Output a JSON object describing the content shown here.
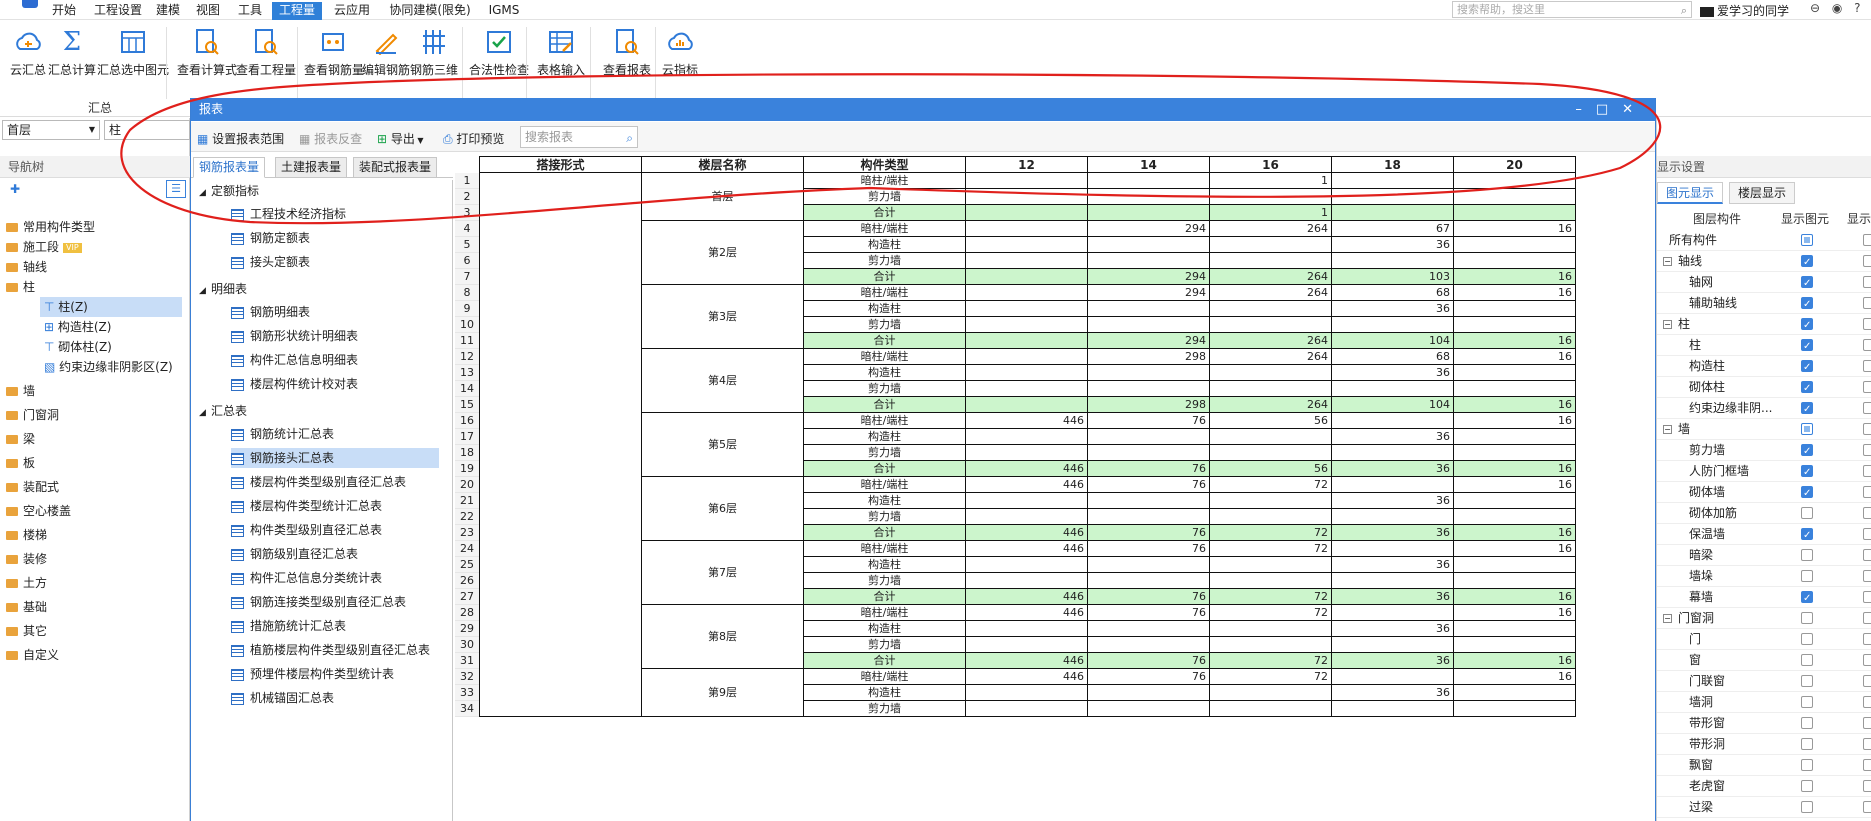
{
  "menu": {
    "items": [
      "开始",
      "工程设置",
      "建模",
      "视图",
      "工具",
      "工程量",
      "云应用",
      "协同建模(限免)",
      "IGMS"
    ],
    "active": "工程量",
    "search_placeholder": "搜索帮助，搜这里",
    "user": "爱学习的同学",
    "right_icons": "⊖ ◉ ? -"
  },
  "ribbon": {
    "buttons": [
      "云汇总",
      "汇总计算",
      "汇总选中图元",
      "查看计算式",
      "查看工程量",
      "查看钢筋量",
      "编辑钢筋",
      "钢筋三维",
      "合法性检查",
      "表格输入",
      "查看报表",
      "云指标"
    ],
    "group_label": "汇总"
  },
  "left": {
    "floor": "首层",
    "type": "柱",
    "nav_title": "导航树",
    "items": [
      "常用构件类型",
      "施工段",
      "轴线",
      "柱",
      "柱(Z)",
      "构造柱(Z)",
      "砌体柱(Z)",
      "约束边缘非阴影区(Z)",
      "墙",
      "门窗洞",
      "梁",
      "板",
      "装配式",
      "空心楼盖",
      "楼梯",
      "装修",
      "土方",
      "基础",
      "其它",
      "自定义"
    ],
    "vip": "VIP"
  },
  "dialog": {
    "title": "报表",
    "toolbar": {
      "set_range": "设置报表范围",
      "check": "报表反查",
      "export": "导出",
      "print": "打印预览",
      "search_placeholder": "搜索报表"
    },
    "tabs": [
      "钢筋报表量",
      "土建报表量",
      "装配式报表量"
    ],
    "tree": {
      "groups": [
        "定额指标",
        "明细表",
        "汇总表"
      ],
      "g1": [
        "工程技术经济指标",
        "钢筋定额表",
        "接头定额表"
      ],
      "g2": [
        "钢筋明细表",
        "钢筋形状统计明细表",
        "构件汇总信息明细表",
        "楼层构件统计校对表"
      ],
      "g3": [
        "钢筋统计汇总表",
        "钢筋接头汇总表",
        "楼层构件类型级别直径汇总表",
        "楼层构件类型统计汇总表",
        "构件类型级别直径汇总表",
        "钢筋级别直径汇总表",
        "构件汇总信息分类统计表",
        "钢筋连接类型级别直径汇总表",
        "措施筋统计汇总表",
        "植筋楼层构件类型级别直径汇总表",
        "预埋件楼层构件类型统计表",
        "机械锚固汇总表"
      ],
      "selected": "钢筋接头汇总表"
    },
    "table": {
      "headers": [
        "搭接形式",
        "楼层名称",
        "构件类型",
        "12",
        "14",
        "16",
        "18",
        "20"
      ],
      "floors": [
        {
          "name": "首层",
          "rows": [
            [
              "暗柱/端柱",
              "",
              "",
              "1",
              "",
              ""
            ],
            [
              "剪力墙",
              "",
              "",
              "",
              "",
              ""
            ],
            [
              "合计",
              "",
              "",
              "1",
              "",
              ""
            ]
          ]
        },
        {
          "name": "第2层",
          "rows": [
            [
              "暗柱/端柱",
              "",
              "294",
              "264",
              "67",
              "16"
            ],
            [
              "构造柱",
              "",
              "",
              "",
              "36",
              ""
            ],
            [
              "剪力墙",
              "",
              "",
              "",
              "",
              ""
            ],
            [
              "合计",
              "",
              "294",
              "264",
              "103",
              "16"
            ]
          ]
        },
        {
          "name": "第3层",
          "rows": [
            [
              "暗柱/端柱",
              "",
              "294",
              "264",
              "68",
              "16"
            ],
            [
              "构造柱",
              "",
              "",
              "",
              "36",
              ""
            ],
            [
              "剪力墙",
              "",
              "",
              "",
              "",
              ""
            ],
            [
              "合计",
              "",
              "294",
              "264",
              "104",
              "16"
            ]
          ]
        },
        {
          "name": "第4层",
          "rows": [
            [
              "暗柱/端柱",
              "",
              "298",
              "264",
              "68",
              "16"
            ],
            [
              "构造柱",
              "",
              "",
              "",
              "36",
              ""
            ],
            [
              "剪力墙",
              "",
              "",
              "",
              "",
              ""
            ],
            [
              "合计",
              "",
              "298",
              "264",
              "104",
              "16"
            ]
          ]
        },
        {
          "name": "第5层",
          "rows": [
            [
              "暗柱/端柱",
              "446",
              "76",
              "56",
              "",
              "16"
            ],
            [
              "构造柱",
              "",
              "",
              "",
              "36",
              ""
            ],
            [
              "剪力墙",
              "",
              "",
              "",
              "",
              ""
            ],
            [
              "合计",
              "446",
              "76",
              "56",
              "36",
              "16"
            ]
          ]
        },
        {
          "name": "第6层",
          "rows": [
            [
              "暗柱/端柱",
              "446",
              "76",
              "72",
              "",
              "16"
            ],
            [
              "构造柱",
              "",
              "",
              "",
              "36",
              ""
            ],
            [
              "剪力墙",
              "",
              "",
              "",
              "",
              ""
            ],
            [
              "合计",
              "446",
              "76",
              "72",
              "36",
              "16"
            ]
          ]
        },
        {
          "name": "第7层",
          "rows": [
            [
              "暗柱/端柱",
              "446",
              "76",
              "72",
              "",
              "16"
            ],
            [
              "构造柱",
              "",
              "",
              "",
              "36",
              ""
            ],
            [
              "剪力墙",
              "",
              "",
              "",
              "",
              ""
            ],
            [
              "合计",
              "446",
              "76",
              "72",
              "36",
              "16"
            ]
          ]
        },
        {
          "name": "第8层",
          "rows": [
            [
              "暗柱/端柱",
              "446",
              "76",
              "72",
              "",
              "16"
            ],
            [
              "构造柱",
              "",
              "",
              "",
              "36",
              ""
            ],
            [
              "剪力墙",
              "",
              "",
              "",
              "",
              ""
            ],
            [
              "合计",
              "446",
              "76",
              "72",
              "36",
              "16"
            ]
          ]
        },
        {
          "name": "第9层",
          "rows": [
            [
              "暗柱/端柱",
              "446",
              "76",
              "72",
              "",
              "16"
            ],
            [
              "构造柱",
              "",
              "",
              "",
              "36",
              ""
            ],
            [
              "剪力墙",
              "",
              "",
              "",
              "",
              ""
            ]
          ]
        }
      ]
    }
  },
  "right": {
    "title": "显示设置",
    "tabs": [
      "图元显示",
      "楼层显示"
    ],
    "col1": "图层构件",
    "col2": "显示图元",
    "col3": "显示",
    "rows": [
      [
        "所有构件",
        "part",
        0
      ],
      [
        "轴线",
        "on",
        1
      ],
      [
        "轴网",
        "on",
        2
      ],
      [
        "辅助轴线",
        "on",
        2
      ],
      [
        "柱",
        "on",
        1
      ],
      [
        "柱",
        "on",
        2
      ],
      [
        "构造柱",
        "on",
        2
      ],
      [
        "砌体柱",
        "on",
        2
      ],
      [
        "约束边缘非阴...",
        "on",
        2
      ],
      [
        "墙",
        "part",
        1
      ],
      [
        "剪力墙",
        "on",
        2
      ],
      [
        "人防门框墙",
        "on",
        2
      ],
      [
        "砌体墙",
        "on",
        2
      ],
      [
        "砌体加筋",
        "off",
        2
      ],
      [
        "保温墙",
        "on",
        2
      ],
      [
        "暗梁",
        "off",
        2
      ],
      [
        "墙垛",
        "off",
        2
      ],
      [
        "幕墙",
        "on",
        2
      ],
      [
        "门窗洞",
        "off",
        1
      ],
      [
        "门",
        "off",
        2
      ],
      [
        "窗",
        "off",
        2
      ],
      [
        "门联窗",
        "off",
        2
      ],
      [
        "墙洞",
        "off",
        2
      ],
      [
        "带形窗",
        "off",
        2
      ],
      [
        "带形洞",
        "off",
        2
      ],
      [
        "飘窗",
        "off",
        2
      ],
      [
        "老虎窗",
        "off",
        2
      ],
      [
        "过梁",
        "off",
        2
      ]
    ]
  },
  "colors": {
    "title_bar": "#3a82dc",
    "sum_row": "#ccf5cc",
    "annotation": "#e0201c"
  }
}
